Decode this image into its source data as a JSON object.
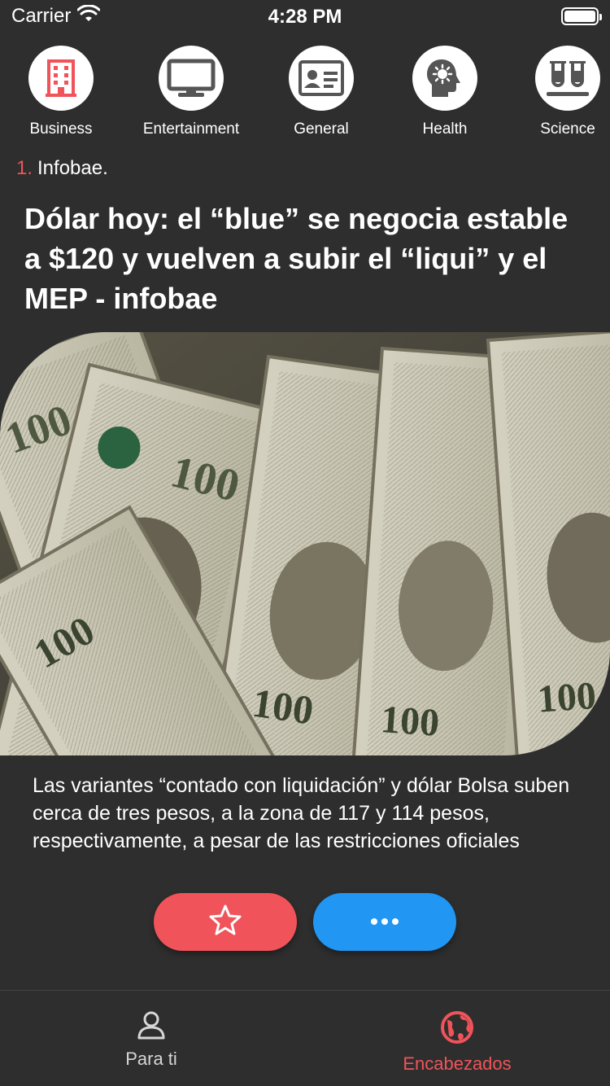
{
  "status_bar": {
    "carrier": "Carrier",
    "time": "4:28 PM",
    "icons": [
      "wifi-icon",
      "battery-icon"
    ]
  },
  "categories": [
    {
      "label": "Business",
      "icon": "building-icon"
    },
    {
      "label": "Entertainment",
      "icon": "monitor-icon"
    },
    {
      "label": "General",
      "icon": "id-card-icon"
    },
    {
      "label": "Health",
      "icon": "head-virus-icon"
    },
    {
      "label": "Science",
      "icon": "test-tubes-icon"
    }
  ],
  "article": {
    "index": "1.",
    "source": "Infobae.",
    "title": "Dólar hoy: el “blue” se negocia estable a $120 y vuelven a subir el “liqui” y el MEP - infobae",
    "image": "dollar-bills-photo",
    "description": "Las variantes “contado con liquidación” y dólar Bolsa suben cerca de tres pesos, a la zona de 117 y 114 pesos, respectivamente, a pesar de las restricciones oficiales"
  },
  "actions": {
    "favorite_icon": "star-icon",
    "more_icon": "more-dots-icon"
  },
  "tab_bar": {
    "items": [
      {
        "label": "Para ti",
        "icon": "user-icon",
        "active": false
      },
      {
        "label": "Encabezados",
        "icon": "globe-icon",
        "active": true
      }
    ]
  },
  "colors": {
    "background": "#2e2e2e",
    "accent_red": "#f0545a",
    "accent_blue": "#2196f3",
    "text": "#ffffff",
    "inactive_tab": "#d6d6d6"
  }
}
